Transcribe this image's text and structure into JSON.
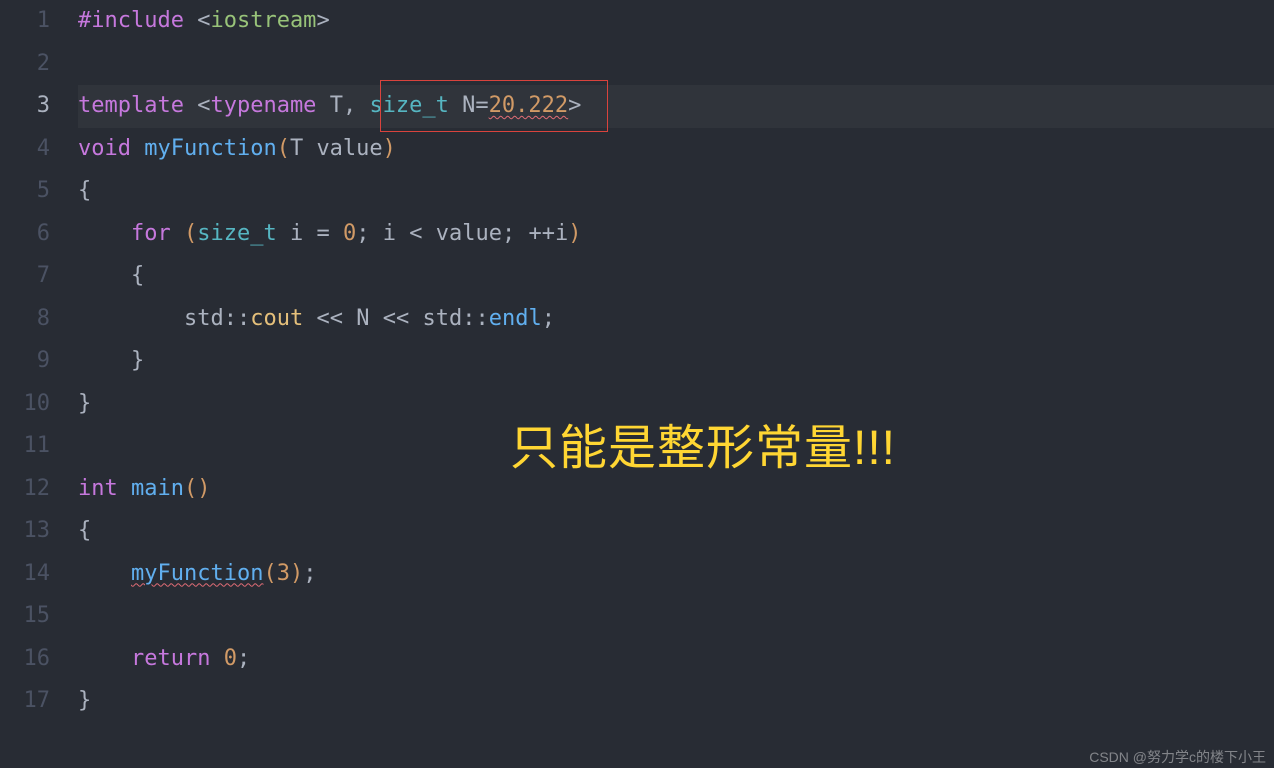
{
  "gutter": {
    "lines": [
      "1",
      "2",
      "3",
      "4",
      "5",
      "6",
      "7",
      "8",
      "9",
      "10",
      "11",
      "12",
      "13",
      "14",
      "15",
      "16",
      "17"
    ],
    "active_index": 2
  },
  "code": {
    "l1": {
      "preproc": "#include",
      "sp": " ",
      "lt": "<",
      "hdr": "iostream",
      "gt": ">"
    },
    "l3": {
      "tmpl": "template",
      "sp1": " ",
      "lt": "<",
      "tn": "typename",
      "sp2": " ",
      "T": "T",
      "comma": ",",
      "sp3": " ",
      "size_t": "size_t",
      "sp4": " ",
      "N": "N",
      "eq": "=",
      "val": "20.222",
      "gt": ">"
    },
    "l4": {
      "void": "void",
      "sp1": " ",
      "fn": "myFunction",
      "lp": "(",
      "T": "T",
      "sp2": " ",
      "arg": "value",
      "rp": ")"
    },
    "l5": {
      "brace": "{"
    },
    "l6": {
      "for": "for",
      "sp": " ",
      "lp": "(",
      "size_t": "size_t",
      "sp2": " ",
      "i": "i",
      "sp3": " ",
      "eq": "=",
      "sp4": " ",
      "zero": "0",
      "semi": ";",
      "sp5": " ",
      "i2": "i",
      "sp6": " ",
      "lt": "<",
      "sp7": " ",
      "val": "value",
      "semi2": ";",
      "sp8": " ",
      "inc": "++",
      "i3": "i",
      "rp": ")"
    },
    "l7": {
      "brace": "{"
    },
    "l8": {
      "std": "std",
      "cc": "::",
      "cout": "cout",
      "sp1": " ",
      "ls": "<<",
      "sp2": " ",
      "N": "N",
      "sp3": " ",
      "ls2": "<<",
      "sp4": " ",
      "std2": "std",
      "cc2": "::",
      "endl": "endl",
      "semi": ";"
    },
    "l9": {
      "brace": "}"
    },
    "l10": {
      "brace": "}"
    },
    "l12": {
      "int": "int",
      "sp": " ",
      "main": "main",
      "lp": "(",
      "rp": ")"
    },
    "l13": {
      "brace": "{"
    },
    "l14": {
      "fn": "myFunction",
      "lp": "(",
      "arg": "3",
      "rp": ")",
      "semi": ";"
    },
    "l16": {
      "ret": "return",
      "sp": " ",
      "zero": "0",
      "semi": ";"
    },
    "l17": {
      "brace": "}"
    }
  },
  "annotation": "只能是整形常量!!!",
  "watermark": "CSDN @努力学c的楼下小王"
}
